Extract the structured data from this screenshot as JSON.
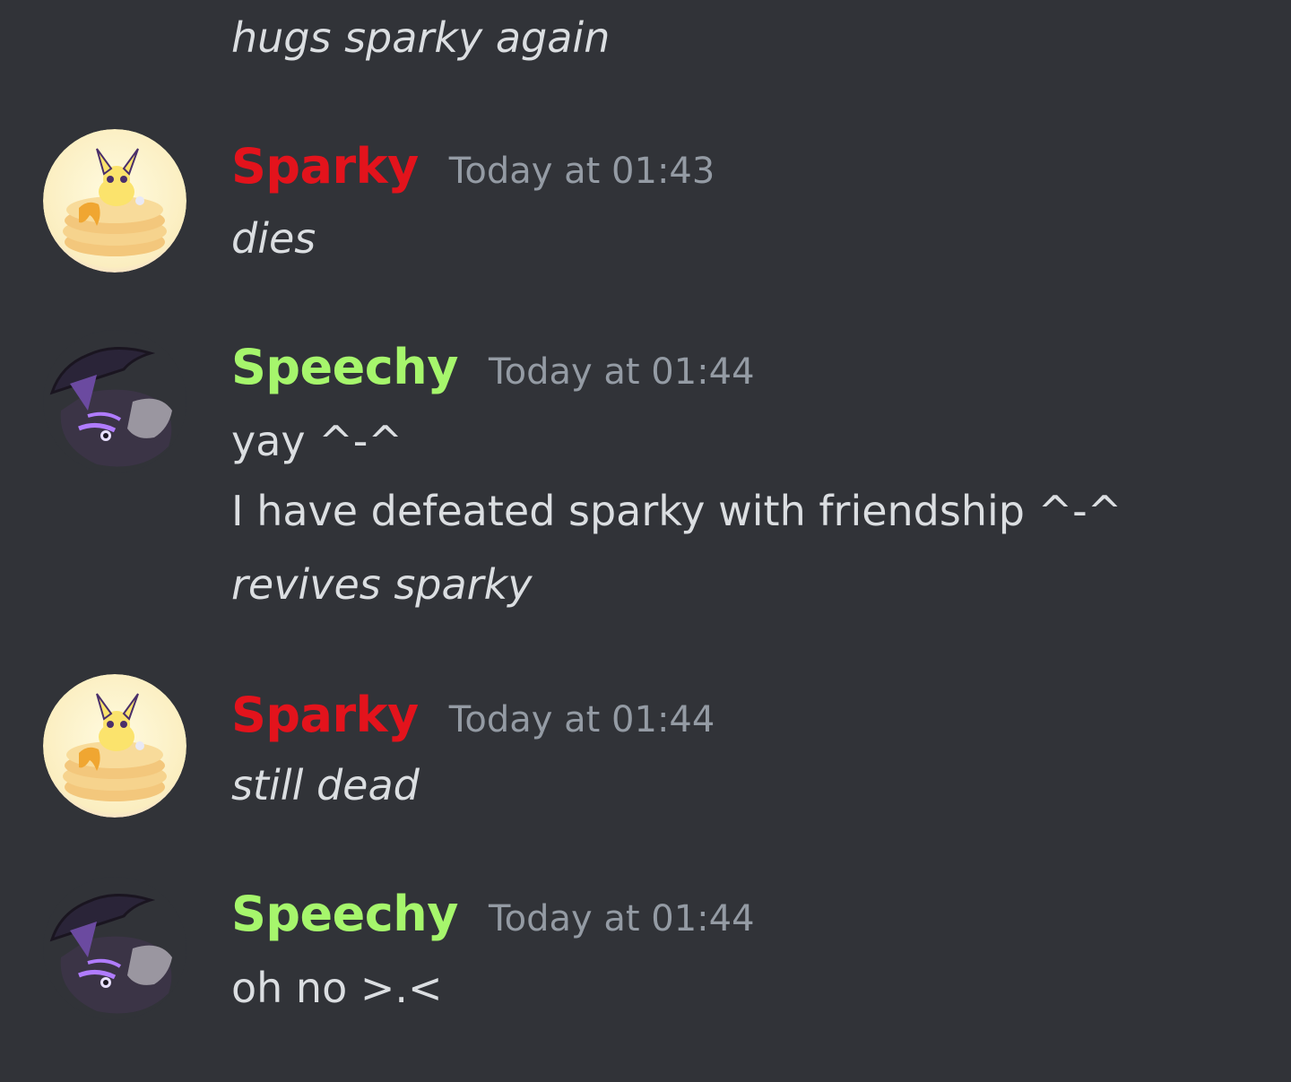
{
  "colors": {
    "background": "#313338",
    "sparky_name": "#e3131c",
    "speechy_name": "#a6f66c",
    "timestamp": "#949ba4",
    "message_text": "#dbdee1"
  },
  "messages": {
    "continuation": {
      "text": "hugs sparky again"
    },
    "m1": {
      "author": "Sparky",
      "timestamp": "Today at 01:43",
      "avatar_icon": "eevee-pancake-avatar-icon",
      "lines": [
        "dies"
      ]
    },
    "m2": {
      "author": "Speechy",
      "timestamp": "Today at 01:44",
      "avatar_icon": "dark-creature-witch-hat-avatar-icon",
      "lines": [
        "yay ^-^",
        "I have defeated sparky with friendship ^-^",
        "revives sparky"
      ]
    },
    "m3": {
      "author": "Sparky",
      "timestamp": "Today at 01:44",
      "avatar_icon": "eevee-pancake-avatar-icon",
      "lines": [
        "still dead"
      ]
    },
    "m4": {
      "author": "Speechy",
      "timestamp": "Today at 01:44",
      "avatar_icon": "dark-creature-witch-hat-avatar-icon",
      "lines": [
        "oh no >.<"
      ]
    }
  }
}
